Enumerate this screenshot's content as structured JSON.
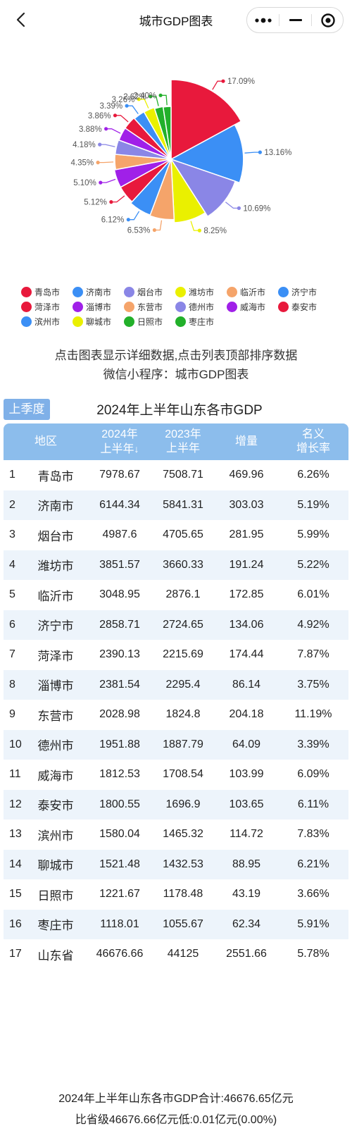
{
  "nav": {
    "title": "城市GDP图表"
  },
  "chart_data": {
    "type": "pie",
    "categories": [
      "青岛市",
      "济南市",
      "烟台市",
      "潍坊市",
      "临沂市",
      "济宁市",
      "菏泽市",
      "淄博市",
      "东营市",
      "德州市",
      "威海市",
      "泰安市",
      "滨州市",
      "聊城市",
      "日照市",
      "枣庄市"
    ],
    "values": [
      17.09,
      13.16,
      10.69,
      8.25,
      6.53,
      6.12,
      5.12,
      5.1,
      4.35,
      4.18,
      3.88,
      3.86,
      3.39,
      3.26,
      2.62,
      2.4
    ],
    "labels": [
      "17.09%",
      "13.16%",
      "10.69%",
      "8.25%",
      "6.53%",
      "6.12%",
      "5.12%",
      "5.10%",
      "4.35%",
      "4.18%",
      "3.88%",
      "3.86%",
      "3.39%",
      "3.26%",
      "2.62%",
      "2.40%"
    ],
    "colors": [
      "#e8193c",
      "#3b8ff5",
      "#8a86e6",
      "#eaf000",
      "#f5a46a",
      "#3b8ff5",
      "#e8193c",
      "#a020e8",
      "#f5a46a",
      "#8a86e6",
      "#a020e8",
      "#e8193c",
      "#3b8ff5",
      "#eaf000",
      "#22b02a",
      "#22b02a"
    ],
    "legend_position": "bottom"
  },
  "hint_lines": [
    "点击图表显示详细数据,点击列表顶部排序数据",
    "微信小程序：城市GDP图表"
  ],
  "tab_label": "上季度",
  "table_title": "2024年上半年山东各市GDP",
  "headers": {
    "region": "地区",
    "h2024_a": "2024年",
    "h2024_b": "上半年",
    "sort_arrow": "↓",
    "h2023_a": "2023年",
    "h2023_b": "上半年",
    "increase": "增量",
    "rate_a": "名义",
    "rate_b": "增长率"
  },
  "rows": [
    {
      "rank": "1",
      "city": "青岛市",
      "v2024": "7978.67",
      "v2023": "7508.71",
      "inc": "469.96",
      "rate": "6.26%"
    },
    {
      "rank": "2",
      "city": "济南市",
      "v2024": "6144.34",
      "v2023": "5841.31",
      "inc": "303.03",
      "rate": "5.19%"
    },
    {
      "rank": "3",
      "city": "烟台市",
      "v2024": "4987.6",
      "v2023": "4705.65",
      "inc": "281.95",
      "rate": "5.99%"
    },
    {
      "rank": "4",
      "city": "潍坊市",
      "v2024": "3851.57",
      "v2023": "3660.33",
      "inc": "191.24",
      "rate": "5.22%"
    },
    {
      "rank": "5",
      "city": "临沂市",
      "v2024": "3048.95",
      "v2023": "2876.1",
      "inc": "172.85",
      "rate": "6.01%"
    },
    {
      "rank": "6",
      "city": "济宁市",
      "v2024": "2858.71",
      "v2023": "2724.65",
      "inc": "134.06",
      "rate": "4.92%"
    },
    {
      "rank": "7",
      "city": "菏泽市",
      "v2024": "2390.13",
      "v2023": "2215.69",
      "inc": "174.44",
      "rate": "7.87%"
    },
    {
      "rank": "8",
      "city": "淄博市",
      "v2024": "2381.54",
      "v2023": "2295.4",
      "inc": "86.14",
      "rate": "3.75%"
    },
    {
      "rank": "9",
      "city": "东营市",
      "v2024": "2028.98",
      "v2023": "1824.8",
      "inc": "204.18",
      "rate": "11.19%"
    },
    {
      "rank": "10",
      "city": "德州市",
      "v2024": "1951.88",
      "v2023": "1887.79",
      "inc": "64.09",
      "rate": "3.39%"
    },
    {
      "rank": "11",
      "city": "威海市",
      "v2024": "1812.53",
      "v2023": "1708.54",
      "inc": "103.99",
      "rate": "6.09%"
    },
    {
      "rank": "12",
      "city": "泰安市",
      "v2024": "1800.55",
      "v2023": "1696.9",
      "inc": "103.65",
      "rate": "6.11%"
    },
    {
      "rank": "13",
      "city": "滨州市",
      "v2024": "1580.04",
      "v2023": "1465.32",
      "inc": "114.72",
      "rate": "7.83%"
    },
    {
      "rank": "14",
      "city": "聊城市",
      "v2024": "1521.48",
      "v2023": "1432.53",
      "inc": "88.95",
      "rate": "6.21%"
    },
    {
      "rank": "15",
      "city": "日照市",
      "v2024": "1221.67",
      "v2023": "1178.48",
      "inc": "43.19",
      "rate": "3.66%"
    },
    {
      "rank": "16",
      "city": "枣庄市",
      "v2024": "1118.01",
      "v2023": "1055.67",
      "inc": "62.34",
      "rate": "5.91%"
    },
    {
      "rank": "17",
      "city": "山东省",
      "v2024": "46676.66",
      "v2023": "44125",
      "inc": "2551.66",
      "rate": "5.78%"
    }
  ],
  "footer_lines": [
    "2024年上半年山东各市GDP合计:46676.65亿元",
    "比省级46676.66亿元低:0.01亿元(0.00%)"
  ]
}
